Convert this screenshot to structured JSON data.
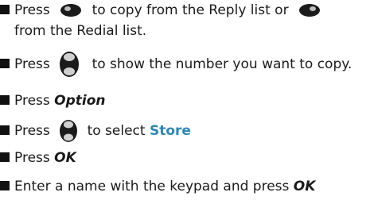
{
  "steps": [
    {
      "part1": "Press",
      "part2": "to copy from the Reply list or",
      "part3": "from the Redial list."
    },
    {
      "part1": "Press",
      "part2": "to show the number you want to copy."
    },
    {
      "part1": "Press",
      "emph": "Option"
    },
    {
      "part1": "Press",
      "part2": "to select",
      "store": "Store"
    },
    {
      "part1": "Press",
      "emph": "OK"
    },
    {
      "part1": "Enter a name with the keypad and press",
      "emph": "OK"
    }
  ],
  "icons": {
    "left_key": "left-nav-key-icon",
    "right_key": "right-nav-key-icon",
    "updown_key": "up-down-nav-key-icon"
  }
}
